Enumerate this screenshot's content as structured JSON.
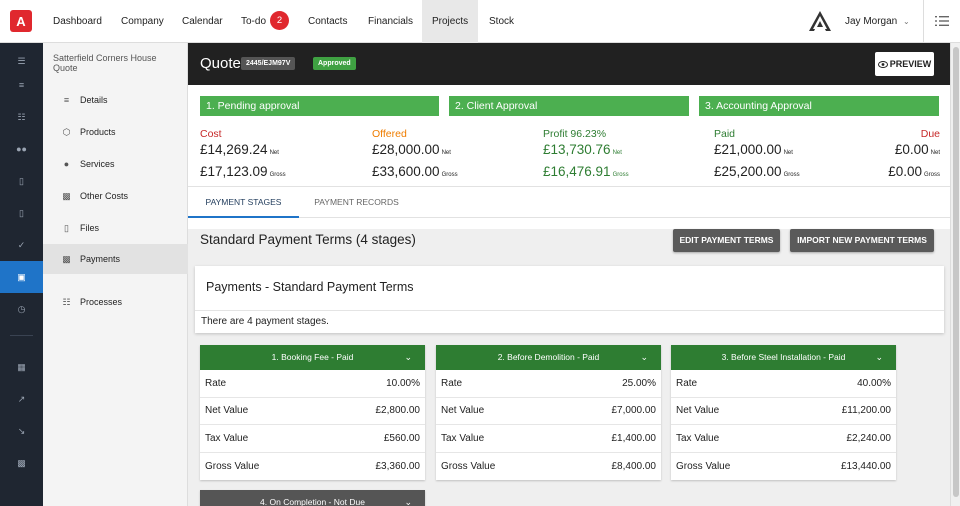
{
  "app": {
    "logo_letter": "A"
  },
  "nav": {
    "items": [
      "Dashboard",
      "Company",
      "Calendar",
      "To-do",
      "Contacts",
      "Financials",
      "Projects",
      "Stock"
    ],
    "todo_count": "2",
    "active": "Projects",
    "user_name": "Jay Morgan"
  },
  "rail": {
    "icons": [
      "menu-icon",
      "list-icon",
      "org-chart-icon",
      "people-icon",
      "document-icon",
      "document-icon",
      "check-icon",
      "cart-icon",
      "clock-icon",
      "dashboard-icon",
      "trending-up-icon",
      "trending-down-icon",
      "money-icon"
    ],
    "active": "cart-icon"
  },
  "sidebar": {
    "project_name": "Satterfield Corners House Quote",
    "items": [
      {
        "label": "Details",
        "icon": "list-icon"
      },
      {
        "label": "Products",
        "icon": "box-icon"
      },
      {
        "label": "Services",
        "icon": "person-icon"
      },
      {
        "label": "Other Costs",
        "icon": "money-icon"
      },
      {
        "label": "Files",
        "icon": "file-icon"
      },
      {
        "label": "Payments",
        "icon": "money-icon"
      },
      {
        "label": "Processes",
        "icon": "org-chart-icon"
      }
    ],
    "active": "Payments"
  },
  "quote": {
    "title": "Quote",
    "number": "2445/EJM97V",
    "status": "Approved",
    "preview_label": "PREVIEW"
  },
  "approvals": [
    "1. Pending approval",
    "2. Client Approval",
    "3. Accounting Approval"
  ],
  "financials": {
    "cost": {
      "label": "Cost",
      "net": "£14,269.24",
      "gross": "£17,123.09"
    },
    "offered": {
      "label": "Offered",
      "net": "£28,000.00",
      "gross": "£33,600.00"
    },
    "profit": {
      "label": "Profit 96.23%",
      "net": "£13,730.76",
      "gross": "£16,476.91"
    },
    "paid": {
      "label": "Paid",
      "net": "£21,000.00",
      "gross": "£25,200.00"
    },
    "due": {
      "label": "Due",
      "net": "£0.00",
      "gross": "£0.00"
    },
    "net_suffix": "Net",
    "gross_suffix": "Gross"
  },
  "tabs": [
    "PAYMENT STAGES",
    "PAYMENT RECORDS"
  ],
  "terms": {
    "title": "Standard Payment Terms (4 stages)",
    "edit_label": "EDIT PAYMENT TERMS",
    "import_label": "IMPORT NEW PAYMENT TERMS",
    "card_title": "Payments - Standard Payment Terms",
    "card_sub": "There are 4 payment stages."
  },
  "row_labels": {
    "rate": "Rate",
    "net": "Net Value",
    "tax": "Tax Value",
    "gross": "Gross Value"
  },
  "stages": [
    {
      "title": "1. Booking Fee - Paid",
      "rate": "10.00%",
      "net": "£2,800.00",
      "tax": "£560.00",
      "gross": "£3,360.00",
      "color": "#2e7d32"
    },
    {
      "title": "2. Before Demolition - Paid",
      "rate": "25.00%",
      "net": "£7,000.00",
      "tax": "£1,400.00",
      "gross": "£8,400.00",
      "color": "#2e7d32"
    },
    {
      "title": "3. Before Steel Installation - Paid",
      "rate": "40.00%",
      "net": "£11,200.00",
      "tax": "£2,240.00",
      "gross": "£13,440.00",
      "color": "#2e7d32"
    },
    {
      "title": "4. On Completion - Not Due",
      "color": "#555555"
    }
  ]
}
